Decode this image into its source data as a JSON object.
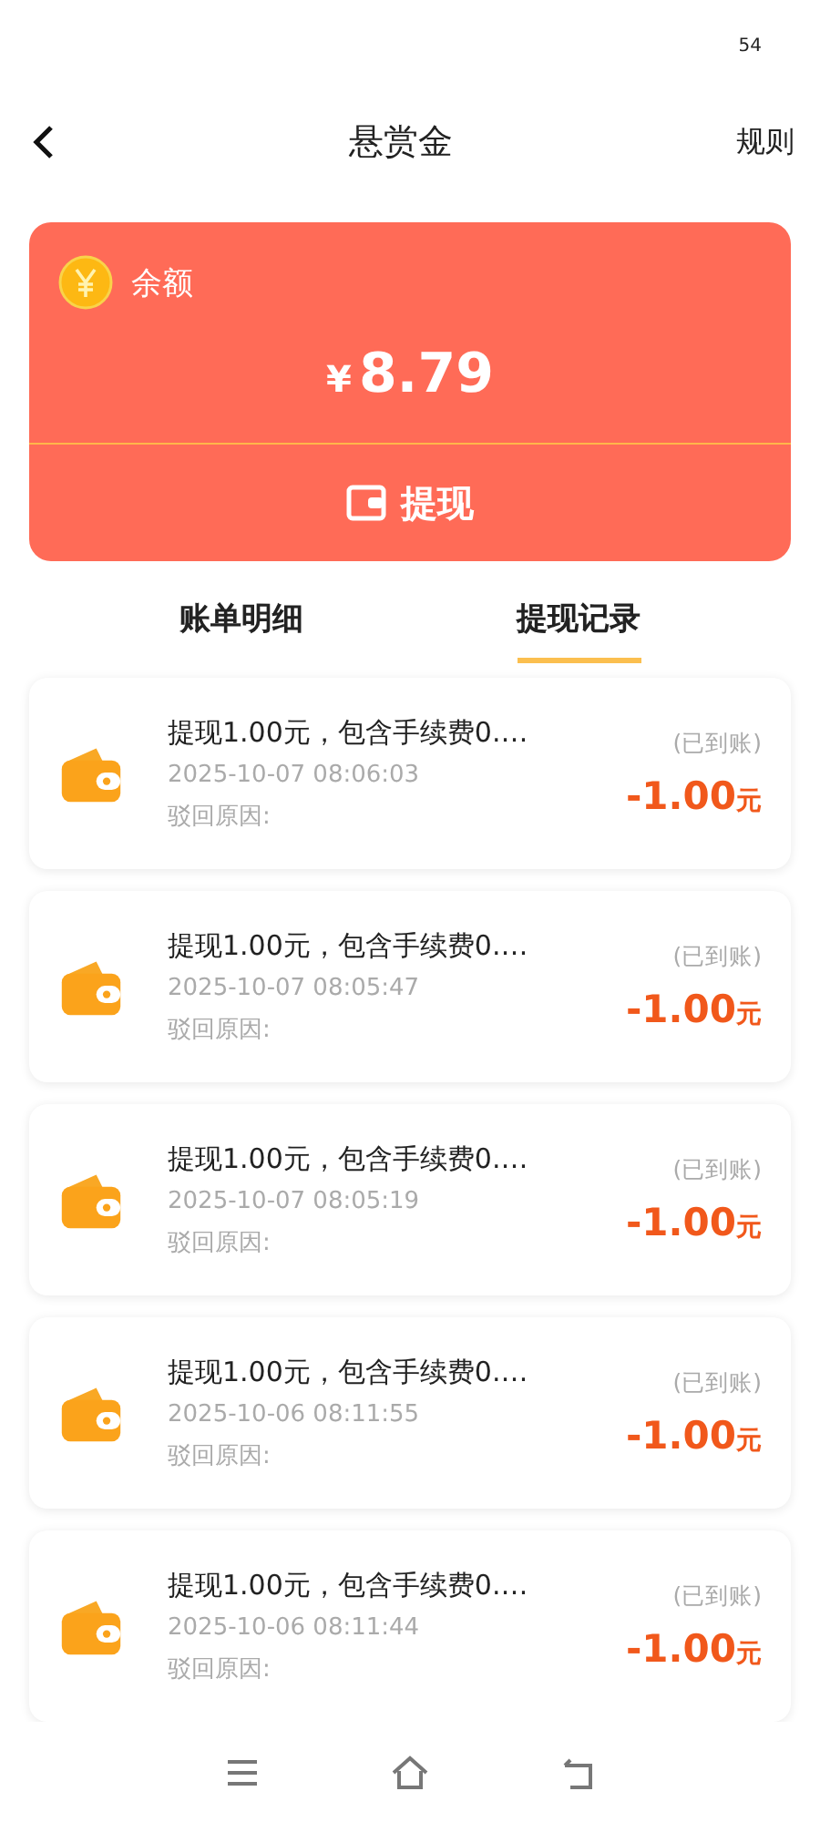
{
  "status_bar": {
    "battery": "54"
  },
  "header": {
    "title": "悬赏金",
    "rules": "规则"
  },
  "balance": {
    "label": "余额",
    "currency": "¥",
    "amount": "8.79",
    "withdraw": "提现"
  },
  "tabs": [
    {
      "label": "账单明细",
      "selected": false
    },
    {
      "label": "提现记录",
      "selected": true
    }
  ],
  "records": [
    {
      "title": "提现1.00元，包含手续费0.…",
      "time": "2025-10-07 08:06:03",
      "reason": "驳回原因:",
      "status": "(已到账)",
      "amount": "-1.00",
      "unit": "元"
    },
    {
      "title": "提现1.00元，包含手续费0.…",
      "time": "2025-10-07 08:05:47",
      "reason": "驳回原因:",
      "status": "(已到账)",
      "amount": "-1.00",
      "unit": "元"
    },
    {
      "title": "提现1.00元，包含手续费0.…",
      "time": "2025-10-07 08:05:19",
      "reason": "驳回原因:",
      "status": "(已到账)",
      "amount": "-1.00",
      "unit": "元"
    },
    {
      "title": "提现1.00元，包含手续费0.…",
      "time": "2025-10-06 08:11:55",
      "reason": "驳回原因:",
      "status": "(已到账)",
      "amount": "-1.00",
      "unit": "元"
    },
    {
      "title": "提现1.00元，包含手续费0.…",
      "time": "2025-10-06 08:11:44",
      "reason": "驳回原因:",
      "status": "(已到账)",
      "amount": "-1.00",
      "unit": "元"
    }
  ]
}
